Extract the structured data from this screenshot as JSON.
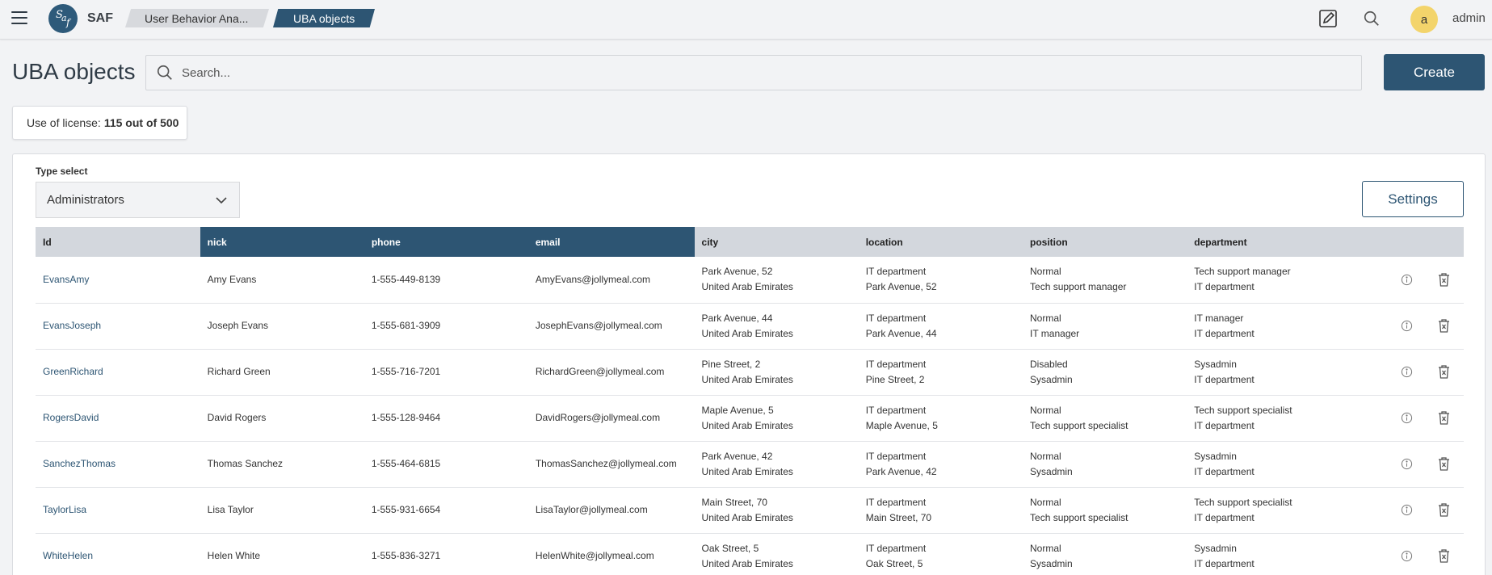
{
  "header": {
    "logo_alt": "saf",
    "app_name": "SAF",
    "breadcrumbs": [
      "User Behavior Ana...",
      "UBA objects"
    ],
    "avatar_letter": "a",
    "user_name": "admin"
  },
  "page": {
    "title": "UBA objects",
    "search_placeholder": "Search...",
    "create_label": "Create",
    "license_prefix": "Use of license:",
    "license_value": "115 out of 500"
  },
  "panel": {
    "type_label": "Type select",
    "type_value": "Administrators",
    "settings_label": "Settings"
  },
  "table": {
    "columns": [
      "Id",
      "nick",
      "phone",
      "email",
      "city",
      "location",
      "position",
      "department"
    ],
    "rows": [
      {
        "id": "EvansAmy",
        "nick": "Amy Evans",
        "phone": "1-555-449-8139",
        "email": "AmyEvans@jollymeal.com",
        "city": [
          "Park Avenue, 52",
          "United Arab Emirates"
        ],
        "location": [
          "IT department",
          "Park Avenue, 52"
        ],
        "position": [
          "Normal",
          "Tech support manager"
        ],
        "department": [
          "Tech support manager",
          "IT department"
        ]
      },
      {
        "id": "EvansJoseph",
        "nick": "Joseph Evans",
        "phone": "1-555-681-3909",
        "email": "JosephEvans@jollymeal.com",
        "city": [
          "Park Avenue, 44",
          "United Arab Emirates"
        ],
        "location": [
          "IT department",
          "Park Avenue, 44"
        ],
        "position": [
          "Normal",
          "IT manager"
        ],
        "department": [
          "IT manager",
          "IT department"
        ]
      },
      {
        "id": "GreenRichard",
        "nick": "Richard Green",
        "phone": "1-555-716-7201",
        "email": "RichardGreen@jollymeal.com",
        "city": [
          "Pine Street, 2",
          "United Arab Emirates"
        ],
        "location": [
          "IT department",
          "Pine Street, 2"
        ],
        "position": [
          "Disabled",
          "Sysadmin"
        ],
        "department": [
          "Sysadmin",
          "IT department"
        ]
      },
      {
        "id": "RogersDavid",
        "nick": "David Rogers",
        "phone": "1-555-128-9464",
        "email": "DavidRogers@jollymeal.com",
        "city": [
          "Maple Avenue, 5",
          "United Arab Emirates"
        ],
        "location": [
          "IT department",
          "Maple Avenue, 5"
        ],
        "position": [
          "Normal",
          "Tech support specialist"
        ],
        "department": [
          "Tech support specialist",
          "IT department"
        ]
      },
      {
        "id": "SanchezThomas",
        "nick": "Thomas Sanchez",
        "phone": "1-555-464-6815",
        "email": "ThomasSanchez@jollymeal.com",
        "city": [
          "Park Avenue, 42",
          "United Arab Emirates"
        ],
        "location": [
          "IT department",
          "Park Avenue, 42"
        ],
        "position": [
          "Normal",
          "Sysadmin"
        ],
        "department": [
          "Sysadmin",
          "IT department"
        ]
      },
      {
        "id": "TaylorLisa",
        "nick": "Lisa Taylor",
        "phone": "1-555-931-6654",
        "email": "LisaTaylor@jollymeal.com",
        "city": [
          "Main Street, 70",
          "United Arab Emirates"
        ],
        "location": [
          "IT department",
          "Main Street, 70"
        ],
        "position": [
          "Normal",
          "Tech support specialist"
        ],
        "department": [
          "Tech support specialist",
          "IT department"
        ]
      },
      {
        "id": "WhiteHelen",
        "nick": "Helen White",
        "phone": "1-555-836-3271",
        "email": "HelenWhite@jollymeal.com",
        "city": [
          "Oak Street, 5",
          "United Arab Emirates"
        ],
        "location": [
          "IT department",
          "Oak Street, 5"
        ],
        "position": [
          "Normal",
          "Sysadmin"
        ],
        "department": [
          "Sysadmin",
          "IT department"
        ]
      }
    ]
  },
  "colors": {
    "accent": "#2d5573",
    "avatar": "#f3d46b",
    "header_row": "#d3d7dd",
    "background": "#f2f3f5"
  },
  "icons": [
    "menu-icon",
    "logo-icon",
    "edit-icon",
    "search-icon",
    "chevron-down-icon",
    "info-icon",
    "trash-icon"
  ]
}
